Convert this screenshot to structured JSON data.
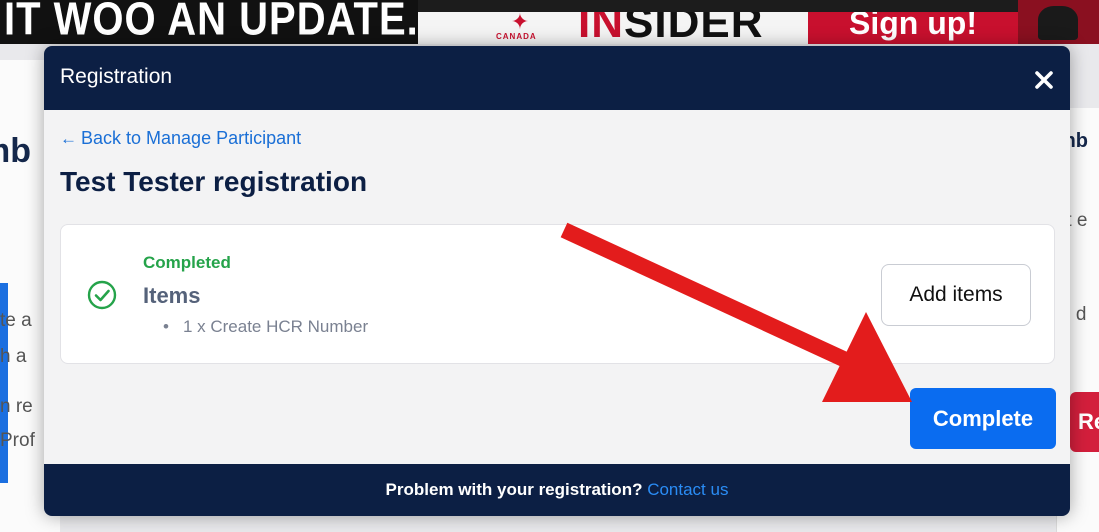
{
  "background": {
    "banner_left_text": "IT WOO AN UPDATE.",
    "banner_logo_text": "CANADA",
    "banner_insider_prefix": "IN",
    "banner_insider_suffix": "SIDER",
    "banner_signup_text": "Sign up!",
    "left_title_fragment": "mb",
    "left_text_lines": [
      "te a",
      "h a",
      "n re",
      "Prof"
    ],
    "right_title_fragment": "mb",
    "right_text_lines": [
      "rt e",
      "d d"
    ],
    "right_button_fragment": "Re"
  },
  "modal": {
    "title": "Registration",
    "back_link": "Back to Manage Participant",
    "page_title": "Test Tester registration",
    "item_card": {
      "status": "Completed",
      "title": "Items",
      "items": [
        "1 x Create HCR Number"
      ],
      "add_button": "Add items"
    },
    "complete_button": "Complete",
    "footer": {
      "text": "Problem with your registration? ",
      "link": "Contact us"
    }
  },
  "colors": {
    "header_bg": "#0c1f44",
    "link": "#1a6fd6",
    "success": "#25a34a",
    "primary_button": "#0a6cf0",
    "annotation_arrow": "#e31c1c"
  },
  "icons": {
    "close": "close-icon",
    "back": "arrow-left-icon",
    "status": "check-circle-icon"
  }
}
